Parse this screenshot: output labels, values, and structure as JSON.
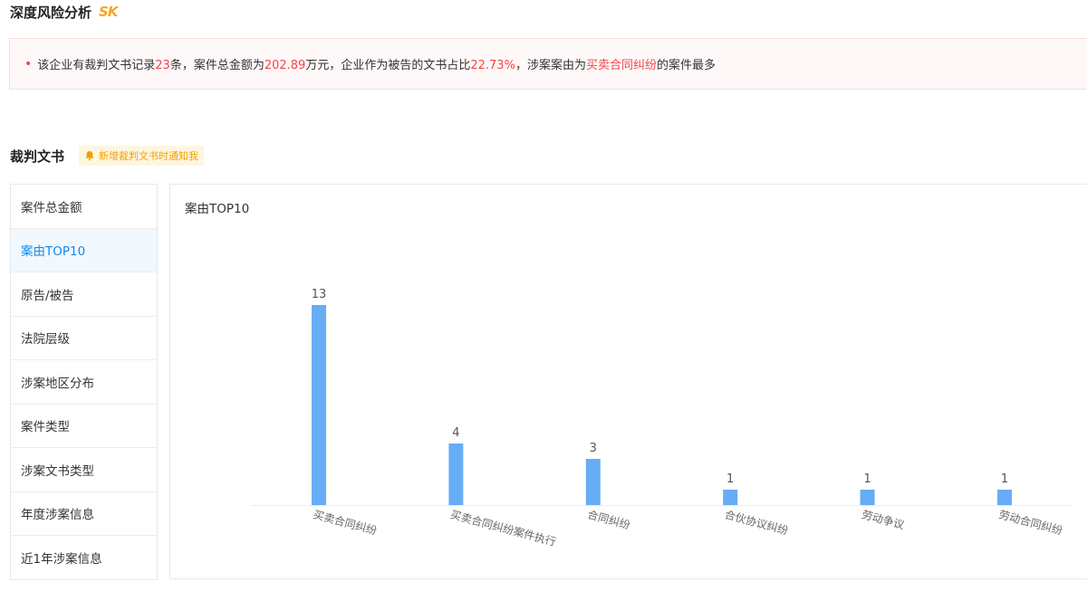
{
  "header": {
    "title": "深度风险分析",
    "logo_text": "SK"
  },
  "summary": {
    "p1": "该企业有裁判文书记录",
    "records": "23",
    "p2": "条，案件总金额为",
    "amount": "202.89",
    "p3": "万元，企业作为被告的文书占比",
    "defendant_ratio": "22.73%",
    "p4": "，涉案案由为",
    "top_cause": "买卖合同纠纷",
    "p5": "的案件最多",
    "highlight_color": "#f0454a"
  },
  "section": {
    "title": "裁判文书",
    "notify_label": "新增裁判文书时通知我"
  },
  "tabs": [
    {
      "label": "案件总金额"
    },
    {
      "label": "案由TOP10",
      "active": true
    },
    {
      "label": "原告/被告"
    },
    {
      "label": "法院层级"
    },
    {
      "label": "涉案地区分布"
    },
    {
      "label": "案件类型"
    },
    {
      "label": "涉案文书类型"
    },
    {
      "label": "年度涉案信息"
    },
    {
      "label": "近1年涉案信息"
    }
  ],
  "chart": {
    "panel_title": "案由TOP10"
  },
  "chart_data": {
    "type": "bar",
    "categories": [
      "买卖合同纠纷",
      "买卖合同纠纷案件执行",
      "合同纠纷",
      "合伙协议纠纷",
      "劳动争议",
      "劳动合同纠纷"
    ],
    "values": [
      13,
      4,
      3,
      1,
      1,
      1
    ],
    "ylim": [
      0,
      13
    ],
    "grid": false,
    "data_labels": true,
    "bar_color": "#66adf6"
  }
}
